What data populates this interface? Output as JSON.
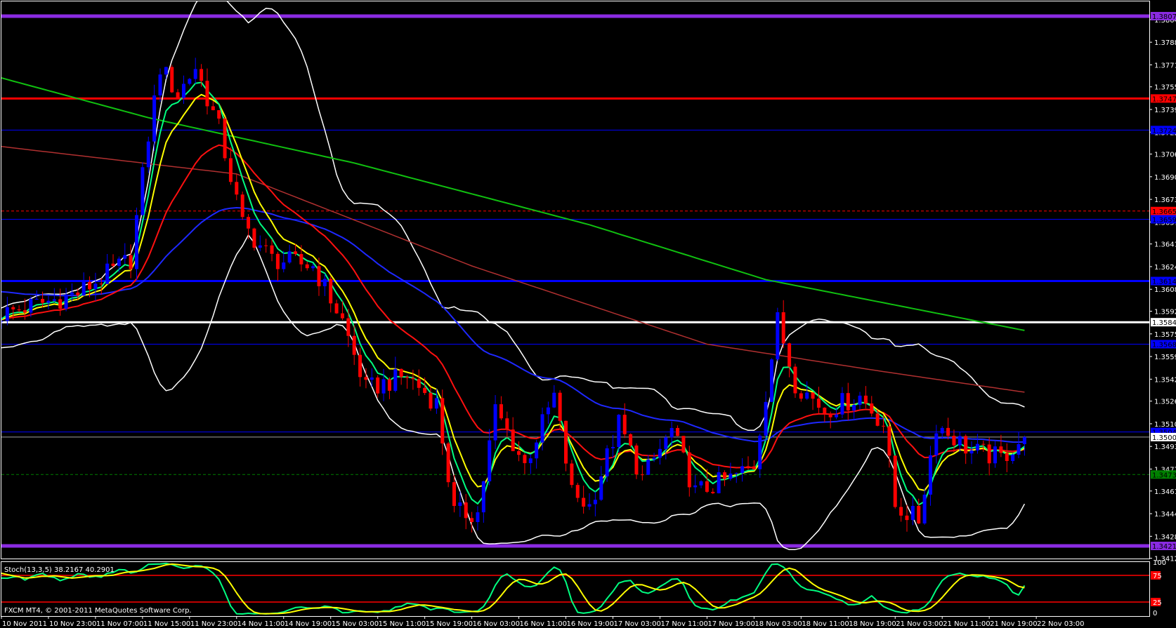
{
  "window": {
    "copyright": "FXCM MT4, © 2001-2011 MetaQuotes Software Corp."
  },
  "colors": {
    "background": "#000000",
    "bull": "#0000ff",
    "bear": "#ff0000",
    "ema_fast": "#00ff80",
    "ema_8": "#ffff00",
    "ema_21": "#ff1010",
    "ema_55": "#1e28ff",
    "ma_200": "#10c010",
    "ma_long": "#b03030",
    "bollinger": "#ffffff",
    "stoch_main": "#00ff80",
    "stoch_signal": "#ffff00",
    "stoch_levels": "#ff0000"
  },
  "chart_data": {
    "type": "candlestick",
    "symbol_timeframe": "H1",
    "ylim": [
      1.3412,
      1.3812
    ],
    "price_axis_labels": [
      "1.38045",
      "1.37880",
      "1.37715",
      "1.37555",
      "1.37390",
      "1.37225",
      "1.37065",
      "1.36900",
      "1.36735",
      "1.36570",
      "1.36410",
      "1.36245",
      "1.36080",
      "1.35920",
      "1.35755",
      "1.35590",
      "1.35425",
      "1.35265",
      "1.35100",
      "1.34935",
      "1.34770",
      "1.34610",
      "1.34445",
      "1.34280",
      "1.34120"
    ],
    "time_axis_labels": [
      "10 Nov 2011",
      "10 Nov 23:00",
      "11 Nov 07:00",
      "11 Nov 15:00",
      "11 Nov 23:00",
      "14 Nov 11:00",
      "14 Nov 19:00",
      "15 Nov 03:00",
      "15 Nov 11:00",
      "15 Nov 19:00",
      "16 Nov 03:00",
      "16 Nov 11:00",
      "16 Nov 19:00",
      "17 Nov 03:00",
      "17 Nov 11:00",
      "17 Nov 19:00",
      "18 Nov 03:00",
      "18 Nov 11:00",
      "18 Nov 19:00",
      "21 Nov 03:00",
      "21 Nov 11:00",
      "21 Nov 19:00",
      "22 Nov 03:00"
    ],
    "bar_count": 175,
    "bars_per_time_label": 8,
    "close_path": [
      [
        -40,
        1.366
      ],
      [
        -20,
        1.3565
      ],
      [
        0,
        1.359
      ],
      [
        13,
        1.3605
      ],
      [
        22,
        1.363
      ],
      [
        25,
        1.372
      ],
      [
        27,
        1.377
      ],
      [
        30,
        1.375
      ],
      [
        33,
        1.377
      ],
      [
        37,
        1.3725
      ],
      [
        41,
        1.3655
      ],
      [
        46,
        1.363
      ],
      [
        53,
        1.3625
      ],
      [
        58,
        1.3585
      ],
      [
        62,
        1.3535
      ],
      [
        69,
        1.3545
      ],
      [
        74,
        1.3525
      ],
      [
        77,
        1.3445
      ],
      [
        81,
        1.3445
      ],
      [
        84,
        1.352
      ],
      [
        89,
        1.348
      ],
      [
        94,
        1.353
      ],
      [
        97,
        1.346
      ],
      [
        100,
        1.345
      ],
      [
        105,
        1.351
      ],
      [
        109,
        1.347
      ],
      [
        114,
        1.3505
      ],
      [
        118,
        1.346
      ],
      [
        124,
        1.347
      ],
      [
        128,
        1.348
      ],
      [
        132,
        1.3585
      ],
      [
        135,
        1.354
      ],
      [
        140,
        1.352
      ],
      [
        146,
        1.353
      ],
      [
        150,
        1.351
      ],
      [
        152,
        1.345
      ],
      [
        156,
        1.344
      ],
      [
        159,
        1.351
      ],
      [
        165,
        1.349
      ],
      [
        170,
        1.3485
      ],
      [
        174,
        1.35003
      ]
    ],
    "ma_200_path": [
      [
        0,
        1.3762
      ],
      [
        25,
        1.3733
      ],
      [
        60,
        1.37
      ],
      [
        100,
        1.3655
      ],
      [
        130,
        1.3615
      ],
      [
        174,
        1.3578
      ]
    ],
    "ma_long_path": [
      [
        0,
        1.3712
      ],
      [
        40,
        1.3692
      ],
      [
        80,
        1.3625
      ],
      [
        120,
        1.3568
      ],
      [
        150,
        1.3548
      ],
      [
        174,
        1.3533
      ]
    ],
    "horizontal_lines": [
      {
        "price": 1.3807,
        "label": "1.38070",
        "color": "#8a2be2",
        "text": "#000000",
        "width": 5,
        "dash": false
      },
      {
        "price": 1.3747,
        "label": "1.37470",
        "color": "#ff0000",
        "text": "#000000",
        "width": 3,
        "dash": false
      },
      {
        "price": 1.3724,
        "label": "1.37240",
        "color": "#0000ff",
        "text": "#000000",
        "width": 1,
        "dash": false
      },
      {
        "price": 1.3665,
        "label": "1.36650",
        "color": "#ff0000",
        "text": "#000000",
        "width": 1,
        "dash": true
      },
      {
        "price": 1.3659,
        "label": "1.36590",
        "color": "#0000ff",
        "text": "#000000",
        "width": 1,
        "dash": false
      },
      {
        "price": 1.3614,
        "label": "1.36140",
        "color": "#0000ff",
        "text": "#000000",
        "width": 3,
        "dash": false
      },
      {
        "price": 1.3584,
        "label": "1.35840",
        "color": "#ffffff",
        "text": "#000000",
        "width": 3,
        "dash": false
      },
      {
        "price": 1.3568,
        "label": "1.35680",
        "color": "#0000ff",
        "text": "#000000",
        "width": 1,
        "dash": false
      },
      {
        "price": 1.3504,
        "label": "1.35040",
        "color": "#0000ff",
        "text": "#000000",
        "width": 1,
        "dash": false
      },
      {
        "price": 1.35003,
        "label": "1.35003",
        "color": "#a0a0a0",
        "text": "#000000",
        "width": 1,
        "dash": false,
        "tagcolor": "#ffffff"
      },
      {
        "price": 1.3473,
        "label": "1.34730",
        "color": "#008000",
        "text": "#000000",
        "width": 1,
        "dash": true
      },
      {
        "price": 1.3421,
        "label": "1.34210",
        "color": "#8a2be2",
        "text": "#000000",
        "width": 5,
        "dash": false
      }
    ],
    "stochastic": {
      "label": "Stoch(13,3,5) 38.2167 40.2901",
      "k_period": 13,
      "slowing": 3,
      "d_period": 5,
      "levels": [
        75,
        25
      ],
      "axis_labels": [
        "100",
        "75",
        "25",
        "0"
      ]
    }
  }
}
